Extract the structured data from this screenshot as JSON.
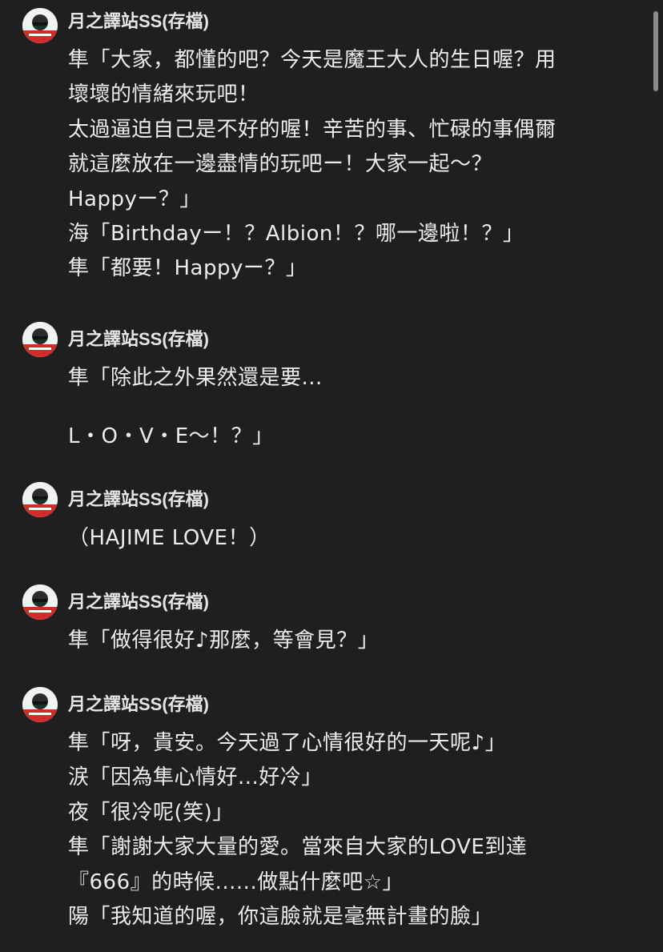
{
  "posts": [
    {
      "author": "月之譯站SS(存檔)",
      "lines": [
        "隼「大家，都懂的吧？今天是魔王大人的生日喔？用",
        "壞壞的情緒來玩吧！",
        "太過逼迫自己是不好的喔！辛苦的事、忙碌的事偶爾",
        "就這麼放在一邊盡情的玩吧ー！大家一起～？",
        "Happyー？」",
        "海「Birthdayー！？Albion！？哪一邊啦！？」",
        "隼「都要！Happyー？」"
      ]
    },
    {
      "author": "月之譯站SS(存檔)",
      "lines": [
        "隼「除此之外果然還是要...",
        "",
        "L・O・V・E～！？」"
      ]
    },
    {
      "author": "月之譯站SS(存檔)",
      "lines": [
        "（HAJIME LOVE！）"
      ]
    },
    {
      "author": "月之譯站SS(存檔)",
      "lines": [
        "隼「做得很好♪那麼，等會見？」"
      ]
    },
    {
      "author": "月之譯站SS(存檔)",
      "lines": [
        "隼「呀，貴安。今天過了心情很好的一天呢♪」",
        "涙「因為隼心情好...好冷」",
        "夜「很冷呢(笑)」",
        "隼「謝謝大家大量的愛。當來自大家的LOVE到達",
        "『666』的時候......做點什麼吧☆」",
        "陽「我知道的喔，你這臉就是毫無計畫的臉」"
      ]
    }
  ],
  "colors": {
    "background": "#1f1f1f",
    "text": "#ececec",
    "avatar_accent": "#d32a2a"
  },
  "icons": {
    "avatar": "user-avatar-icon"
  }
}
